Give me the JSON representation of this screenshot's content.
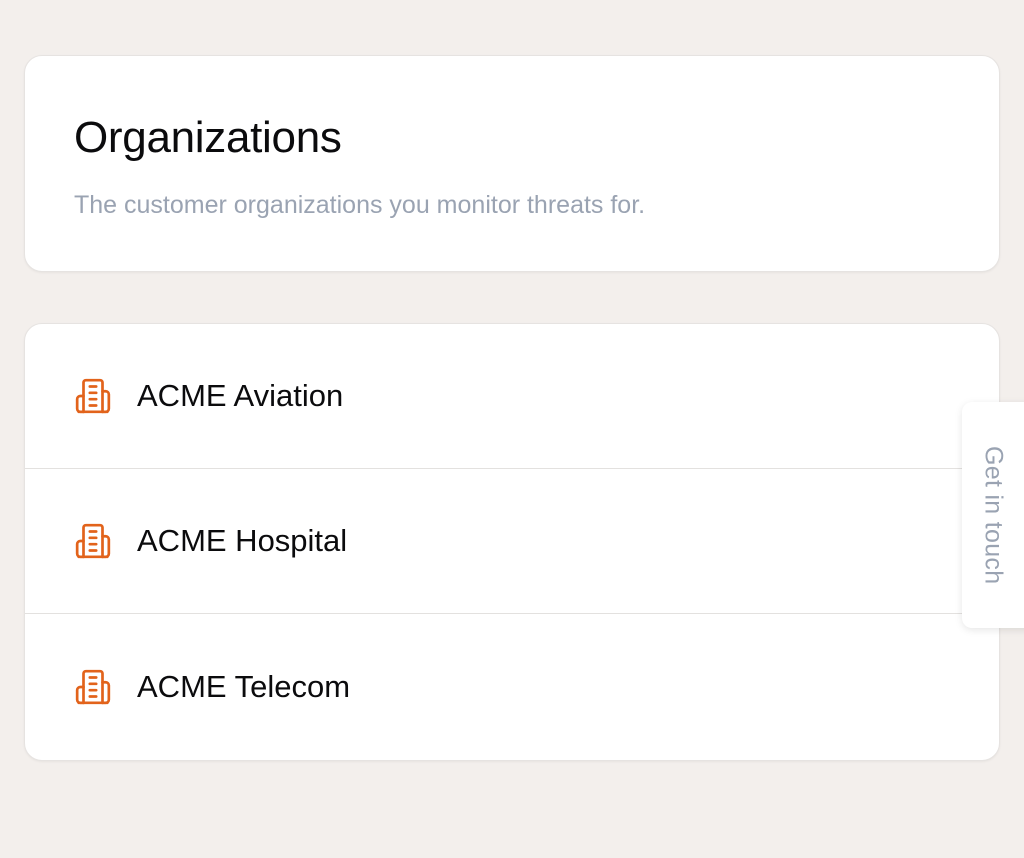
{
  "header": {
    "title": "Organizations",
    "subtitle": "The customer organizations you monitor threats for."
  },
  "organizations": [
    {
      "name": "ACME Aviation",
      "icon": "building-icon"
    },
    {
      "name": "ACME Hospital",
      "icon": "building-icon"
    },
    {
      "name": "ACME Telecom",
      "icon": "building-icon"
    }
  ],
  "feedback_tab": {
    "label": "Get in touch"
  },
  "colors": {
    "background": "#f3efec",
    "accent": "#e2631b",
    "muted_text": "#9aa3b2"
  }
}
